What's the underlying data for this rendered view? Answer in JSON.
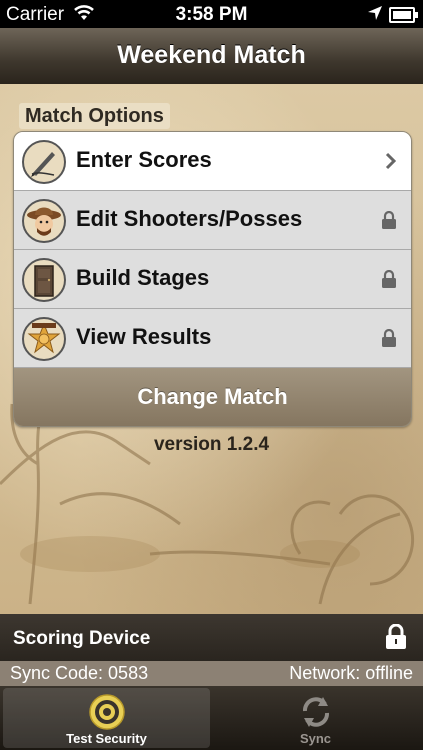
{
  "status_bar": {
    "carrier": "Carrier",
    "time": "3:58 PM"
  },
  "navbar": {
    "title": "Weekend Match"
  },
  "section": {
    "header": "Match Options"
  },
  "menu": {
    "items": [
      {
        "label": "Enter Scores",
        "icon": "pen-icon",
        "accessory": "chevron-right"
      },
      {
        "label": "Edit Shooters/Posses",
        "icon": "cowboy-icon",
        "accessory": "lock"
      },
      {
        "label": "Build Stages",
        "icon": "door-icon",
        "accessory": "lock"
      },
      {
        "label": "View Results",
        "icon": "sheriff-badge-icon",
        "accessory": "lock"
      }
    ],
    "change_match": "Change Match"
  },
  "version": "version 1.2.4",
  "scoring": {
    "label": "Scoring Device",
    "sync_code": "Sync Code: 0583",
    "network": "Network: offline"
  },
  "tabs": [
    {
      "label": "Test Security",
      "icon": "target-icon",
      "selected": true
    },
    {
      "label": "Sync",
      "icon": "sync-icon",
      "selected": false
    }
  ],
  "colors": {
    "navbar": "#3e372d",
    "parchment": "#d9c7a3",
    "accent_gold": "#e0c046"
  }
}
